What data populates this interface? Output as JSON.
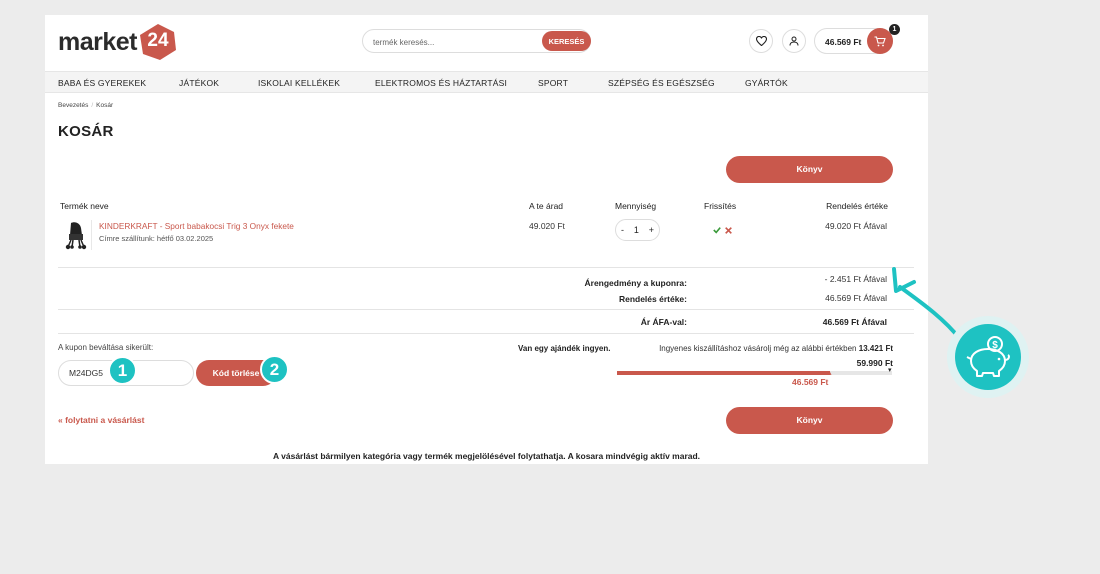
{
  "header": {
    "logo_text": "market",
    "logo_number": "24",
    "search_placeholder": "termék keresés...",
    "search_button": "KERESÉS",
    "cart_total": "46.569 Ft",
    "cart_count": "1"
  },
  "nav": [
    "BABA ÉS GYEREKEK",
    "JÁTÉKOK",
    "ISKOLAI KELLÉKEK",
    "ELEKTROMOS ÉS HÁZTARTÁSI",
    "SPORT",
    "SZÉPSÉG ÉS EGÉSZSÉG",
    "GYÁRTÓK"
  ],
  "breadcrumb": [
    "Bevezetés",
    "Kosár"
  ],
  "page_title": "KOSÁR",
  "primary_button": "Könyv",
  "table": {
    "headers": [
      "Termék neve",
      "A te árad",
      "Mennyiség",
      "Frissítés",
      "Rendelés értéke"
    ],
    "product": {
      "name": "KINDERKRAFT - Sport babakocsi Trig 3 Onyx fekete",
      "shipping": "Címre szállítunk: hétfő 03.02.2025",
      "price": "49.020 Ft",
      "qty_minus": "-",
      "qty": "1",
      "qty_plus": "+",
      "total": "49.020 Ft Áfával"
    }
  },
  "summary": {
    "discount_label": "Árengedmény a kuponra:",
    "discount_value": "- 2.451 Ft Áfával",
    "order_label": "Rendelés értéke:",
    "order_value": "46.569 Ft Áfával",
    "vat_label": "Ár ÁFA-val:",
    "vat_value": "46.569 Ft Áfával"
  },
  "coupon": {
    "label": "A kupon beváltása sikerült:",
    "code": "M24DG5",
    "delete_button": "Kód törlése"
  },
  "steps": [
    "1",
    "2"
  ],
  "shipping": {
    "gift_label": "Van egy ajándék ingyen.",
    "text": "Ingyenes kiszállításhoz vásárolj még az alábbi értékben",
    "remaining": "13.421 Ft",
    "threshold": "59.990 Ft",
    "current": "46.569 Ft",
    "progress_fraction": 0.776
  },
  "continue_link": "« folytatni a vásárlást",
  "footer_note": "A vásárlást bármilyen kategória vagy termék megjelölésével folytathatja. A kosara mindvégig aktív marad.",
  "colors": {
    "accent": "#c9584c",
    "teal": "#1ec2c2",
    "background": "#ececec"
  }
}
